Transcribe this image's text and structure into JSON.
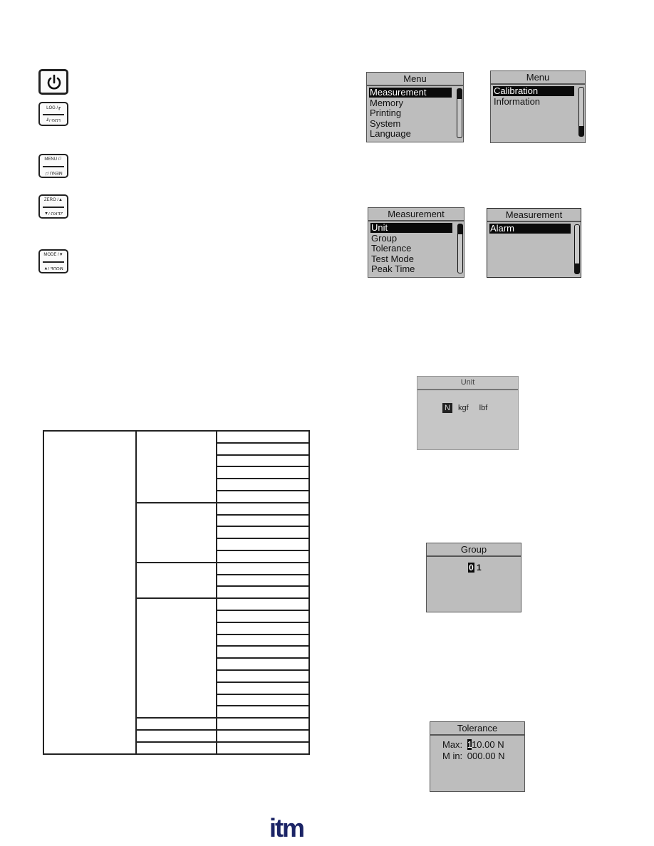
{
  "keys": [
    {
      "name": "power",
      "icon": "power-icon"
    },
    {
      "name": "log",
      "top": "LOG /",
      "bottom": "LOG /",
      "icon": "enter-corner-icon"
    },
    {
      "name": "menu",
      "top": "MENU /",
      "bottom": "MENU /",
      "icon": "enter-icon"
    },
    {
      "name": "zero",
      "top": "ZERO /",
      "bottom": "ZERO /",
      "icon": "up-arrow-icon"
    },
    {
      "name": "mode",
      "top": "MODE /",
      "bottom": "MODE /",
      "icon": "down-arrow-icon"
    }
  ],
  "screens": {
    "menu1": {
      "title": "Menu",
      "items": [
        "Measurement",
        "Memory",
        "Printing",
        "System",
        "Language"
      ],
      "selected": 0
    },
    "menu2": {
      "title": "Menu",
      "items": [
        "Calibration",
        "Information"
      ],
      "selected": 0
    },
    "meas1": {
      "title": "Measurement",
      "items": [
        "Unit",
        "Group",
        "Tolerance",
        "Test Mode",
        "Peak Time"
      ],
      "selected": 0
    },
    "meas2": {
      "title": "Measurement",
      "items": [
        "Alarm"
      ],
      "selected": 0
    },
    "unit": {
      "title": "Unit",
      "options": [
        "N",
        "kgf",
        "lbf"
      ],
      "selected": "N"
    },
    "group": {
      "title": "Group",
      "digits": [
        "0",
        "1"
      ],
      "cursor": 0
    },
    "tolerance": {
      "title": "Tolerance",
      "max_label": "Max:",
      "max_cursor_digit": "1",
      "max_rest": "10.00 N",
      "min_label": "M in:",
      "min_value": "000.00 N"
    }
  },
  "menu_table": {
    "groups": [
      6,
      5,
      3,
      10
    ],
    "single_rows": 3
  },
  "logo": {
    "text": "itm",
    "color": "#1b2466"
  }
}
